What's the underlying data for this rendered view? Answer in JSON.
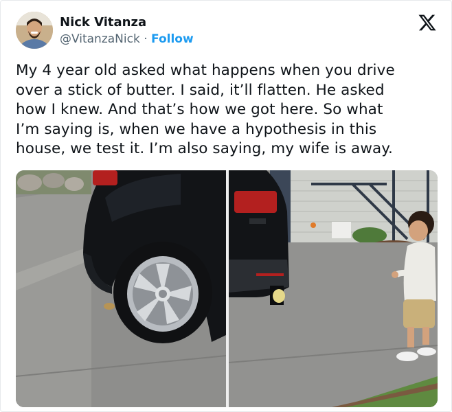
{
  "tweet": {
    "author_name": "Nick Vitanza",
    "handle": "@VitanzaNick",
    "separator": "·",
    "follow_label": "Follow",
    "text_lines": [
      "My 4 year old asked what happens when you drive",
      "over a stick of butter. I said, it’ll flatten. He asked",
      "how I knew. And that’s how we got here. So what",
      "I’m saying is, when we have a hypothesis in this",
      "house, we test it. I’m also saying, my wife is away."
    ]
  },
  "icons": {
    "platform_logo": "x-logo-icon"
  },
  "colors": {
    "text": "#0f1419",
    "secondary": "#536471",
    "accent": "#1d9bf0"
  }
}
